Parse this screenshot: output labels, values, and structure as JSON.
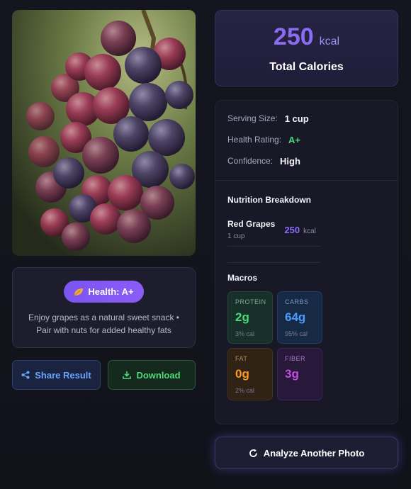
{
  "photo": {
    "alt": "Red grapes"
  },
  "health": {
    "badge_label": "Health: A+",
    "tip": "Enjoy grapes as a natural sweet snack • Pair with nuts for added healthy fats"
  },
  "actions": {
    "share_label": "Share Result",
    "download_label": "Download",
    "analyze_label": "Analyze Another Photo"
  },
  "calories": {
    "value": "250",
    "unit": "kcal",
    "label": "Total Calories"
  },
  "details": {
    "serving_label": "Serving Size:",
    "serving_value": "1 cup",
    "rating_label": "Health Rating:",
    "rating_value": "A+",
    "confidence_label": "Confidence:",
    "confidence_value": "High"
  },
  "breakdown": {
    "title": "Nutrition Breakdown",
    "items": [
      {
        "name": "Red Grapes",
        "qty": "1 cup",
        "calories": "250",
        "unit": "kcal"
      }
    ]
  },
  "macros": {
    "title": "Macros",
    "protein": {
      "label": "PROTEIN",
      "value": "2g",
      "pct": "3% cal"
    },
    "carbs": {
      "label": "CARBS",
      "value": "64g",
      "pct": "95% cal"
    },
    "fat": {
      "label": "FAT",
      "value": "0g",
      "pct": "2% cal"
    },
    "fiber": {
      "label": "FIBER",
      "value": "3g"
    }
  },
  "colors": {
    "accent": "#8b6cf5",
    "green": "#4cd97a",
    "blue": "#4a9cff",
    "orange": "#ff9a1f",
    "purple": "#c04be0"
  }
}
